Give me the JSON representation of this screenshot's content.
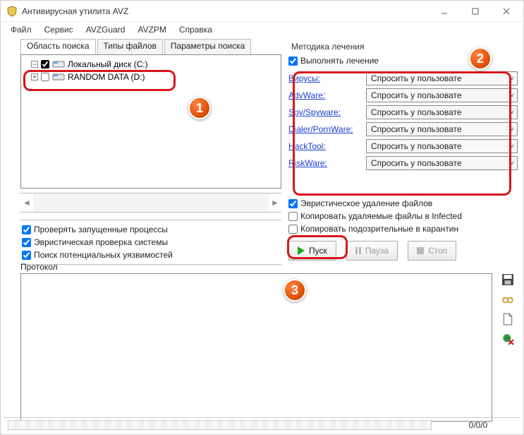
{
  "window": {
    "title": "Антивирусная утилита AVZ"
  },
  "menu": {
    "file": "Файл",
    "service": "Сервис",
    "avzguard": "AVZGuard",
    "avzpm": "AVZPM",
    "help": "Справка"
  },
  "tabs": {
    "scan_area": "Область поиска",
    "file_types": "Типы файлов",
    "search_params": "Параметры поиска"
  },
  "drives": {
    "row1": {
      "expander": "−",
      "label": "Локальный диск (C:)"
    },
    "row2": {
      "expander": "+",
      "label": "RANDOM DATA (D:)"
    }
  },
  "left_checks": {
    "c1": "Проверять запущенные процессы",
    "c2": "Эвристическая проверка системы",
    "c3": "Поиск потенциальных уязвимостей"
  },
  "right": {
    "section": "Методика лечения",
    "perform": "Выполнять лечение",
    "categories": {
      "virus": "Вирусы:",
      "adware": "AdvWare:",
      "spyware": "Spy/Spyware:",
      "dialer": "Dialer/PornWare:",
      "hacktool": "HackTool:",
      "riskware": "RiskWare:"
    },
    "option": "Спросить у пользовате",
    "rc1": "Эвристическое удаление файлов",
    "rc2": "Копировать удаляемые файлы в  Infected",
    "rc3": "Копировать подозрительные в  карантин"
  },
  "buttons": {
    "start": "Пуск",
    "pause": "Пауза",
    "stop": "Стоп"
  },
  "protocol": {
    "label": "Протокол"
  },
  "status": {
    "counter": "0/0/0"
  },
  "badges": {
    "b1": "1",
    "b2": "2",
    "b3": "3"
  }
}
